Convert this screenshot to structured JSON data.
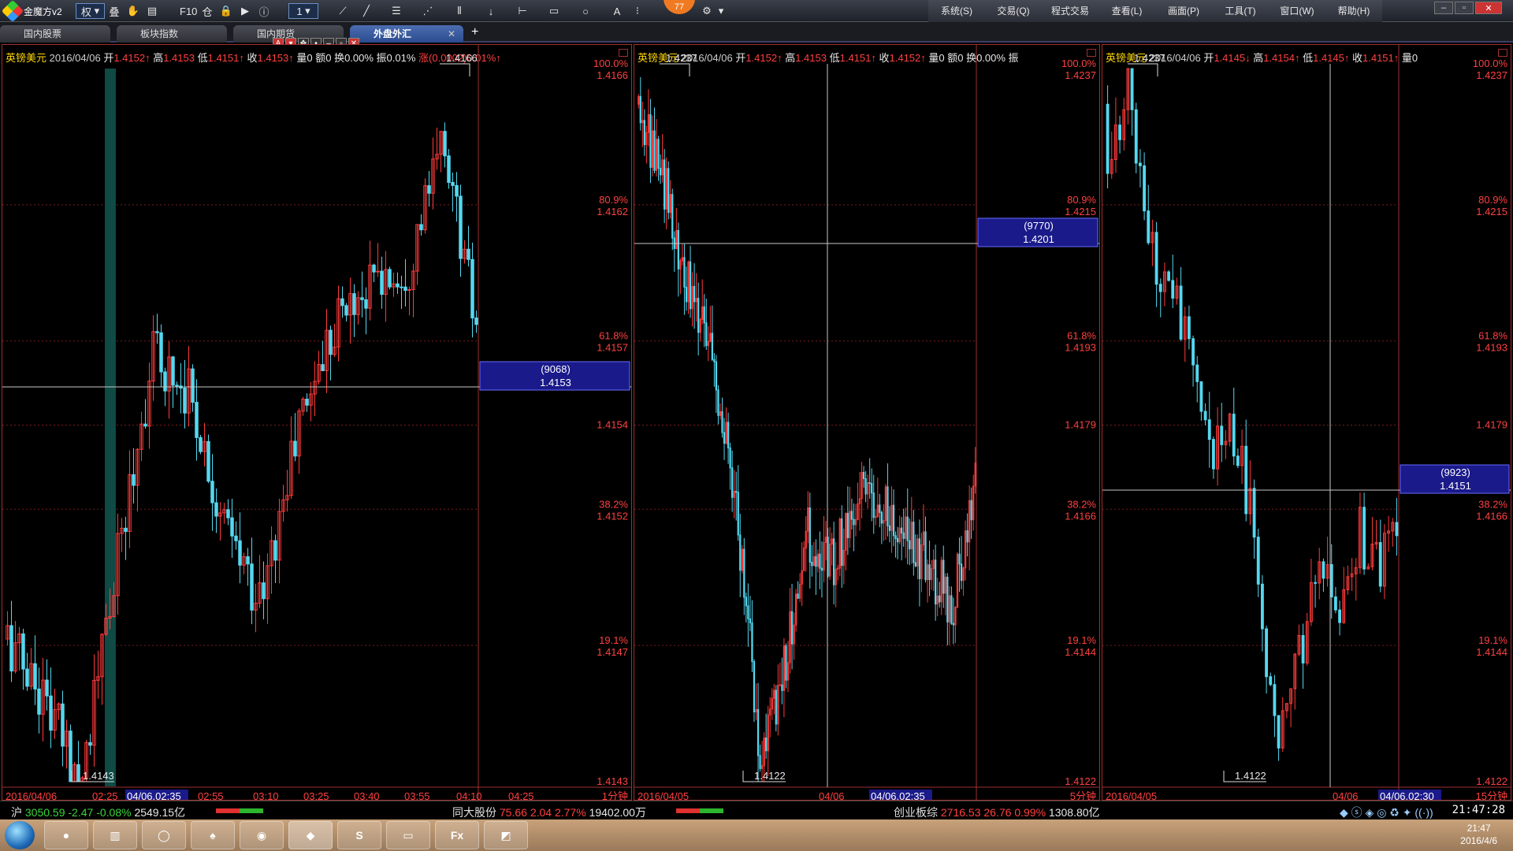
{
  "app": {
    "title": "金魔方v2",
    "right_menu": [
      "系统(S)",
      "交易(Q)",
      "程式交易",
      "查看(L)",
      "画面(P)",
      "工具(T)",
      "窗口(W)",
      "帮助(H)"
    ]
  },
  "toolbar": {
    "quan_label": "权",
    "stack_label": "叠",
    "f10_label": "F10",
    "cang_label": "仓",
    "period_value": "1",
    "font_label": "A",
    "badge": "77"
  },
  "tabs": [
    {
      "label": "国内股票",
      "active": false
    },
    {
      "label": "板块指数",
      "active": false
    },
    {
      "label": "国内期货",
      "active": false
    },
    {
      "label": "外盘外汇",
      "active": true
    }
  ],
  "panels": [
    {
      "id": "p1",
      "header": {
        "symbol": "英镑美元",
        "date": "2016/04/06",
        "open_lbl": "开",
        "open": "1.4152↑",
        "high_lbl": "高",
        "high": "1.4153",
        "low_lbl": "低",
        "low": "1.4151↑",
        "close_lbl": "收",
        "close": "1.4153↑",
        "vol": "量0",
        "amt": "额0",
        "turnover": "换0.00%",
        "amp": "振0.01%",
        "chg": "涨(0.0002)0.01%↑"
      },
      "price_axis": [
        {
          "pct": "100.0%",
          "price": "1.4166"
        },
        {
          "pct": "80.9%",
          "price": "1.4162"
        },
        {
          "pct": "61.8%",
          "price": "1.4157"
        },
        {
          "pct": "",
          "price": "1.4154"
        },
        {
          "pct": "38.2%",
          "price": "1.4152"
        },
        {
          "pct": "19.1%",
          "price": "1.4147"
        },
        {
          "pct": "",
          "price": "1.4143"
        }
      ],
      "high_label": "1.4166",
      "low_label": "1.4143",
      "cursor_tag": {
        "line1": "(9068)",
        "line2": "1.4153"
      },
      "time_axis": [
        "2016/04/06",
        "02:25",
        "04/06,02:35",
        "02:55",
        "03:10",
        "03:25",
        "03:40",
        "03:55",
        "04:10",
        "04:25"
      ],
      "period": "1分钟"
    },
    {
      "id": "p2",
      "header": {
        "symbol": "英镑美元",
        "date": "2016/04/06",
        "open_lbl": "开",
        "open": "1.4152↑",
        "high_lbl": "高",
        "high": "1.4153",
        "low_lbl": "低",
        "low": "1.4151↑",
        "close_lbl": "收",
        "close": "1.4152↑",
        "vol": "量0",
        "amt": "额0",
        "turnover": "换0.00%",
        "amp": "振",
        "chg": ""
      },
      "price_axis": [
        {
          "pct": "100.0%",
          "price": "1.4237"
        },
        {
          "pct": "80.9%",
          "price": "1.4215"
        },
        {
          "pct": "61.8%",
          "price": "1.4193"
        },
        {
          "pct": "",
          "price": "1.4179"
        },
        {
          "pct": "38.2%",
          "price": "1.4166"
        },
        {
          "pct": "19.1%",
          "price": "1.4144"
        },
        {
          "pct": "",
          "price": "1.4122"
        }
      ],
      "high_label": "1.4237",
      "low_label": "1.4122",
      "cursor_tag": {
        "line1": "(9770)",
        "line2": "1.4201"
      },
      "time_axis": [
        "2016/04/05",
        "04/06",
        "04/06,02:35"
      ],
      "period": "5分钟"
    },
    {
      "id": "p3",
      "header": {
        "symbol": "英镑美元",
        "date": "2016/04/06",
        "open_lbl": "开",
        "open": "1.4145↓",
        "high_lbl": "高",
        "high": "1.4154↑",
        "low_lbl": "低",
        "low": "1.4145↑",
        "close_lbl": "收",
        "close": "1.4151↑",
        "vol": "量0",
        "amt": "",
        "turnover": "",
        "amp": "",
        "chg": ""
      },
      "price_axis": [
        {
          "pct": "100.0%",
          "price": "1.4237"
        },
        {
          "pct": "80.9%",
          "price": "1.4215"
        },
        {
          "pct": "61.8%",
          "price": "1.4193"
        },
        {
          "pct": "",
          "price": "1.4179"
        },
        {
          "pct": "38.2%",
          "price": "1.4166"
        },
        {
          "pct": "19.1%",
          "price": "1.4144"
        },
        {
          "pct": "",
          "price": "1.4122"
        }
      ],
      "high_label": "1.4237",
      "low_label": "1.4122",
      "cursor_tag": {
        "line1": "(9923)",
        "line2": "1.4151"
      },
      "time_axis": [
        "2016/04/05",
        "04/06",
        "04/06,02:30"
      ],
      "period": "15分钟"
    }
  ],
  "status": {
    "sh_lbl": "沪",
    "sh_val": "3050.59",
    "sh_chg": "-2.47",
    "sh_pct": "-0.08%",
    "sh_amt": "2549.15亿",
    "stk_lbl": "同大股份",
    "stk_val": "75.66",
    "stk_chg": "2.04",
    "stk_pct": "2.77%",
    "stk_amt": "19402.00万",
    "cy_lbl": "创业板综",
    "cy_val": "2716.53",
    "cy_chg": "26.76",
    "cy_pct": "0.99%",
    "cy_amt": "1308.80亿",
    "clock": "21:47:28"
  },
  "taskbar": {
    "time": "21:47",
    "date": "2016/4/6",
    "fx_label": "Fx"
  },
  "colors": {
    "up": "#ff3b3b",
    "down": "#54d8f0",
    "grid": "#7a1c1c",
    "axis_text": "#ff4040",
    "cursor": "#c8c8c8"
  }
}
